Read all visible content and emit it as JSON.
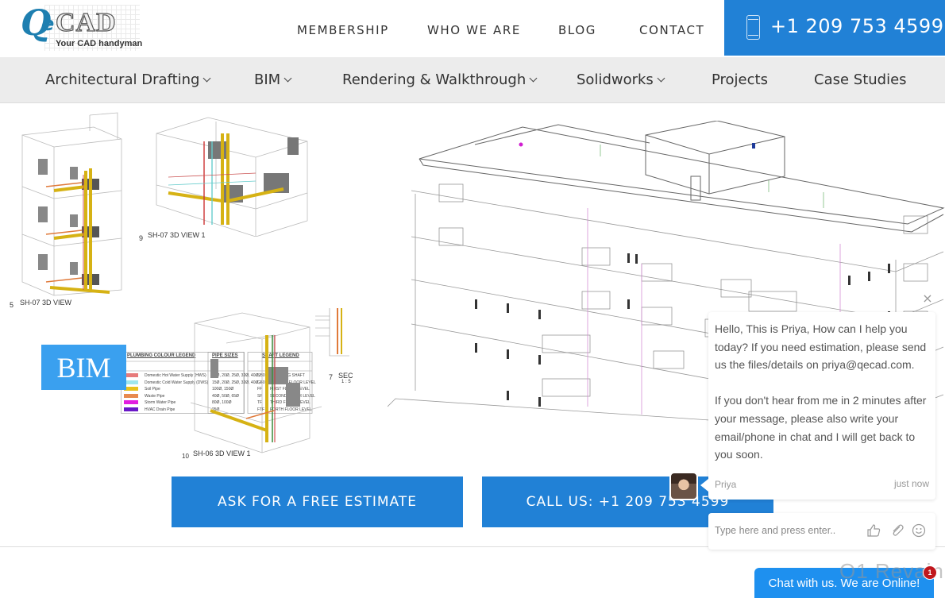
{
  "brand": {
    "logo_letters": "Qe",
    "logo_q": "Q",
    "logo_e": "e",
    "logo_word": "CAD",
    "tagline": "Your CAD handyman",
    "accent_color": "#2181d6"
  },
  "top_nav": {
    "items": [
      {
        "label": "MEMBERSHIP"
      },
      {
        "label": "WHO WE ARE"
      },
      {
        "label": "BLOG"
      },
      {
        "label": "CONTACT"
      }
    ],
    "phone": "+1 209 753 4599",
    "phone_icon": "mobile-phone-icon"
  },
  "main_nav": {
    "items": [
      {
        "label": "Architectural Drafting",
        "has_dropdown": true
      },
      {
        "label": "BIM",
        "has_dropdown": true
      },
      {
        "label": "Rendering & Walkthrough",
        "has_dropdown": true
      },
      {
        "label": "Solidworks",
        "has_dropdown": true
      },
      {
        "label": "Projects",
        "has_dropdown": false
      },
      {
        "label": "Case Studies",
        "has_dropdown": false
      }
    ]
  },
  "hero": {
    "badge": "BIM",
    "captions": {
      "view5_num": "5",
      "view5": "SH-07 3D VIEW",
      "view9_num": "9",
      "view9": "SH-07 3D VIEW 1",
      "view10_num": "10",
      "view10": "SH-06 3D VIEW 1",
      "section7_num": "7",
      "section7": "SEC",
      "section7_scale": "1 : 5"
    },
    "legend": {
      "title": "PLUMBING COLOUR LEGEND",
      "pipe_sizes_title": "PIPE SIZES",
      "shaft_title": "SHAFT LEGEND",
      "rows": [
        {
          "color": "#e77b7b",
          "label": "Domestic Hot Water Supply (HWS)",
          "sizes": "15Ø, 20Ø, 25Ø, 32Ø, 40Ø, 50Ø, 65Ø",
          "code": "SH",
          "name": "PLUMBING SHAFT"
        },
        {
          "color": "#9fe6ee",
          "label": "Domestic Cold Water Supply (DWS)",
          "sizes": "15Ø, 20Ø, 25Ø, 32Ø, 40Ø, 50Ø, 65Ø",
          "code": "GF",
          "name": "GROUND FLOOR LEVEL"
        },
        {
          "color": "#e8c21e",
          "label": "Soil Pipe",
          "sizes": "100Ø, 150Ø",
          "code": "FF",
          "name": "FIRST FLOOR LEVEL"
        },
        {
          "color": "#e88a4e",
          "label": "Waste Pipe",
          "sizes": "40Ø, 50Ø, 65Ø",
          "code": "SF",
          "name": "SECOND FLOOR LEVEL"
        },
        {
          "color": "#e21ee0",
          "label": "Storm Water Pipe",
          "sizes": "80Ø, 100Ø",
          "code": "TF",
          "name": "THIRD FLOOR LEVEL"
        },
        {
          "color": "#6a18c8",
          "label": "HVAC Drain Pipe",
          "sizes": "25Ø",
          "code": "FTF",
          "name": "FORTH FLOOR LEVEL"
        }
      ]
    }
  },
  "cta": {
    "estimate": "ASK FOR A FREE ESTIMATE",
    "call": "CALL US: +1 209 753 4599"
  },
  "chat": {
    "close_icon": "×",
    "message": "Hello, This is Priya, How can I help you today? If you need estimation, please send us the files/details on priya@qecad.com.\n\nIf you don't hear from me in 2 minutes after your message, please also write your email/phone in chat and I will get back to you soon.",
    "agent_name": "Priya",
    "timestamp": "just now",
    "input_placeholder": "Type here and press enter..",
    "launcher_label": "Chat with us. We are Online!",
    "badge_count": "1",
    "watermark": "O1 Revain"
  }
}
